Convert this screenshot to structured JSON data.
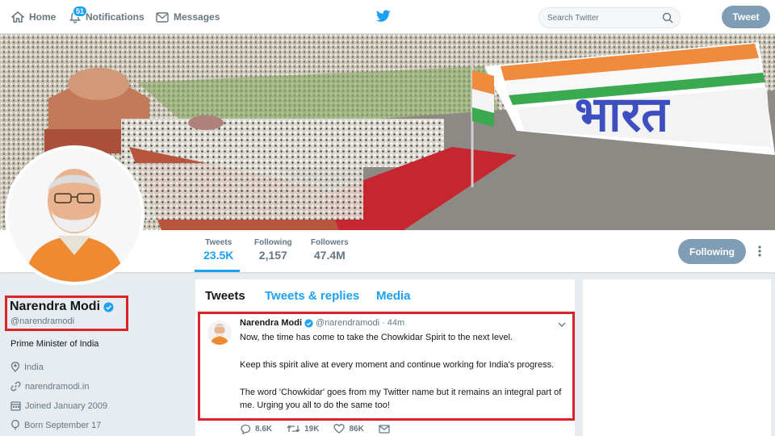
{
  "nav": {
    "home_label": "Home",
    "notifications_label": "Notifications",
    "notifications_count": "51",
    "messages_label": "Messages",
    "search_placeholder": "Search Twitter",
    "tweet_button": "Tweet"
  },
  "profile_nav": {
    "tweets_label": "Tweets",
    "tweets_value": "23.5K",
    "following_label": "Following",
    "following_value": "2,157",
    "followers_label": "Followers",
    "followers_value": "47.4M",
    "follow_button": "Following"
  },
  "profile": {
    "name": "Narendra Modi",
    "handle": "@narendramodi",
    "bio": "Prime Minister of India",
    "location": "India",
    "website": "narendramodi.in",
    "joined": "Joined January 2009",
    "born": "Born September 17"
  },
  "tabs": {
    "tweets": "Tweets",
    "replies": "Tweets & replies",
    "media": "Media"
  },
  "tweet": {
    "name": "Narendra Modi",
    "handle": "@narendramodi",
    "dot": "·",
    "time": "44m",
    "line1": "Now, the time has come to take the Chowkidar Spirit to the next level.",
    "line2": "Keep this spirit alive at every moment and continue working for India's progress.",
    "line3": "The word 'Chowkidar' goes from my Twitter name but it remains an integral part of me. Urging you all to do the same too!",
    "replies": "8.6K",
    "retweets": "19K",
    "likes": "86K"
  },
  "colors": {
    "twitter_blue": "#1da1f2",
    "highlight_red": "#d9252a",
    "button_gray_blue": "#7f9db5"
  },
  "banner_text": "भारत"
}
